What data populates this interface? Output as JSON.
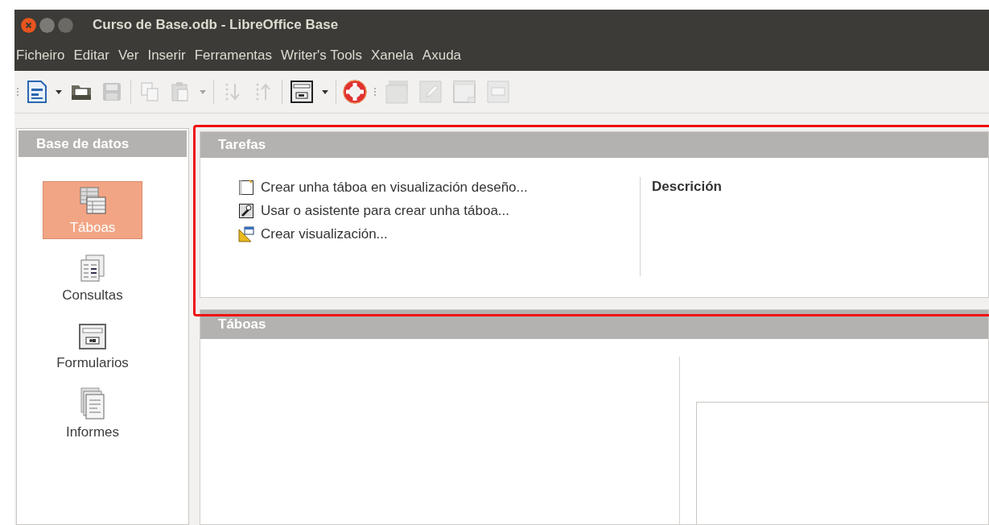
{
  "window": {
    "title": "Curso de Base.odb - LibreOffice Base"
  },
  "menu": [
    "Ficheiro",
    "Editar",
    "Ver",
    "Inserir",
    "Ferramentas",
    "Writer's Tools",
    "Xanela",
    "Axuda"
  ],
  "toolbar": [
    {
      "kind": "grip"
    },
    {
      "kind": "document",
      "disabled": false
    },
    {
      "kind": "caret",
      "disabled": false
    },
    {
      "kind": "folder",
      "disabled": false
    },
    {
      "kind": "floppy",
      "disabled": true
    },
    {
      "kind": "separator"
    },
    {
      "kind": "copy",
      "disabled": true
    },
    {
      "kind": "paste",
      "disabled": true
    },
    {
      "kind": "caret",
      "disabled": true
    },
    {
      "kind": "separator"
    },
    {
      "kind": "sortdown",
      "disabled": true
    },
    {
      "kind": "sortup",
      "disabled": true
    },
    {
      "kind": "separator"
    },
    {
      "kind": "form",
      "disabled": false
    },
    {
      "kind": "caret",
      "disabled": false
    },
    {
      "kind": "separator"
    },
    {
      "kind": "lifebuoy",
      "disabled": false
    },
    {
      "kind": "grip"
    },
    {
      "kind": "folders",
      "disabled": true
    },
    {
      "kind": "edit",
      "disabled": true
    },
    {
      "kind": "window",
      "disabled": true
    },
    {
      "kind": "field",
      "disabled": true
    }
  ],
  "sidebar": {
    "title": "Base de datos",
    "items": [
      {
        "kind": "tables",
        "label": "Táboas",
        "selected": true
      },
      {
        "kind": "queries",
        "label": "Consultas",
        "selected": false
      },
      {
        "kind": "forms",
        "label": "Formularios",
        "selected": false
      },
      {
        "kind": "reports",
        "label": "Informes",
        "selected": false
      }
    ]
  },
  "tasks": {
    "title": "Tarefas",
    "items": [
      {
        "kind": "design",
        "label": "Crear unha táboa en visualización deseño..."
      },
      {
        "kind": "wizard",
        "label": "Usar o asistente para crear unha táboa..."
      },
      {
        "kind": "view",
        "label": "Crear visualización..."
      }
    ],
    "description_title": "Descrición"
  },
  "list_section": {
    "title": "Táboas"
  },
  "annotation": {
    "kind": "frame"
  }
}
